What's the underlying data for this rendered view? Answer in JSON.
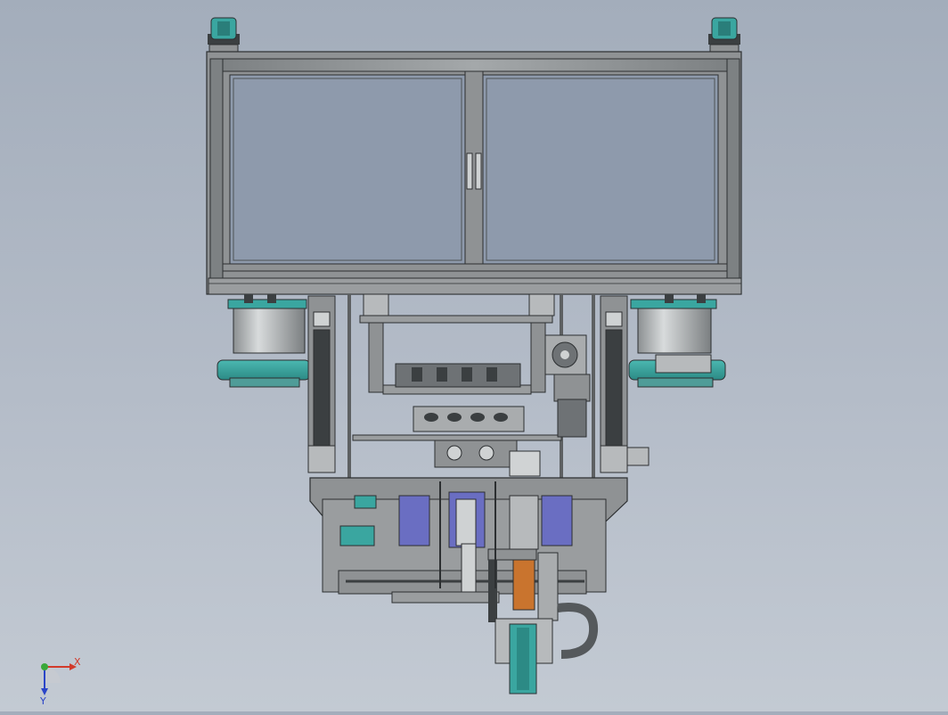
{
  "viewport": {
    "background_top": "#a3adbb",
    "background_bottom": "#c3cad3"
  },
  "model": {
    "colors": {
      "frame": "#8f9294",
      "frame_dark": "#5d6062",
      "glass": "#8e9aac",
      "teal": "#3aa6a0",
      "motor_grey": "#a9acae",
      "blue_purple": "#6a6ec2",
      "orange": "#c9742e",
      "cable": "#55595c",
      "edge": "#2c2f31"
    }
  },
  "triad": {
    "x_label": "X",
    "y_label": "Y",
    "x_color": "#d23a2a",
    "y_color": "#2a44c8",
    "z_color": "#3aa83a"
  }
}
